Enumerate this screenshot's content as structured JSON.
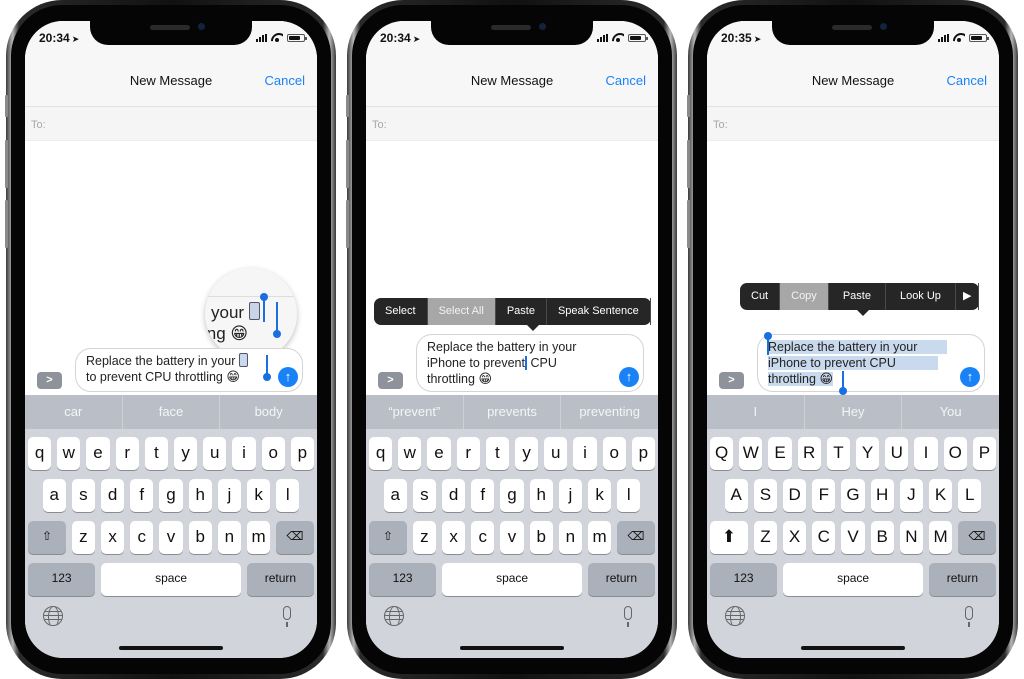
{
  "phones": [
    {
      "status": {
        "time": "20:34",
        "battery_level": 0.8
      },
      "nav": {
        "title": "New Message",
        "cancel": "Cancel"
      },
      "to_label": "To:",
      "expand_icon": ">",
      "message": {
        "line1": "Replace the battery in your",
        "line2": "to prevent CPU throttling",
        "emoji": "😁"
      },
      "magnifier": {
        "line1": "your",
        "line2": "ing",
        "emoji": "😁"
      },
      "send_icon": "↑",
      "suggestions": [
        "car",
        "face",
        "body"
      ],
      "keyboard": {
        "row1": [
          "q",
          "w",
          "e",
          "r",
          "t",
          "y",
          "u",
          "i",
          "o",
          "p"
        ],
        "row2": [
          "a",
          "s",
          "d",
          "f",
          "g",
          "h",
          "j",
          "k",
          "l"
        ],
        "row3": [
          "z",
          "x",
          "c",
          "v",
          "b",
          "n",
          "m"
        ],
        "shift": "⇧",
        "delete": "⌫",
        "numbers": "123",
        "space": "space",
        "return": "return"
      }
    },
    {
      "status": {
        "time": "20:34",
        "battery_level": 0.8
      },
      "nav": {
        "title": "New Message",
        "cancel": "Cancel"
      },
      "to_label": "To:",
      "expand_icon": ">",
      "message": {
        "line1": "Replace the battery in your",
        "line2a": "iPhone to prevent",
        "line2b": " CPU",
        "line3": "throttling",
        "emoji": "😁"
      },
      "edit_menu": [
        "Select",
        "Select All",
        "Paste",
        "Speak Sentence"
      ],
      "edit_menu_active": "Select All",
      "send_icon": "↑",
      "suggestions": [
        "“prevent”",
        "prevents",
        "preventing"
      ],
      "keyboard": {
        "row1": [
          "q",
          "w",
          "e",
          "r",
          "t",
          "y",
          "u",
          "i",
          "o",
          "p"
        ],
        "row2": [
          "a",
          "s",
          "d",
          "f",
          "g",
          "h",
          "j",
          "k",
          "l"
        ],
        "row3": [
          "z",
          "x",
          "c",
          "v",
          "b",
          "n",
          "m"
        ],
        "shift": "⇧",
        "delete": "⌫",
        "numbers": "123",
        "space": "space",
        "return": "return"
      }
    },
    {
      "status": {
        "time": "20:35",
        "battery_level": 0.8
      },
      "nav": {
        "title": "New Message",
        "cancel": "Cancel"
      },
      "to_label": "To:",
      "expand_icon": ">",
      "message": {
        "line1": "Replace the battery in your",
        "line2": "iPhone to prevent CPU",
        "line3": "throttling",
        "emoji": "😁"
      },
      "edit_menu": [
        "Cut",
        "Copy",
        "Paste",
        "Look Up",
        "▶"
      ],
      "edit_menu_active": "Copy",
      "send_icon": "↑",
      "suggestions": [
        "I",
        "Hey",
        "You"
      ],
      "keyboard": {
        "row1": [
          "Q",
          "W",
          "E",
          "R",
          "T",
          "Y",
          "U",
          "I",
          "O",
          "P"
        ],
        "row2": [
          "A",
          "S",
          "D",
          "F",
          "G",
          "H",
          "J",
          "K",
          "L"
        ],
        "row3": [
          "Z",
          "X",
          "C",
          "V",
          "B",
          "N",
          "M"
        ],
        "shift": "⬆",
        "delete": "⌫",
        "numbers": "123",
        "space": "space",
        "return": "return"
      }
    }
  ]
}
